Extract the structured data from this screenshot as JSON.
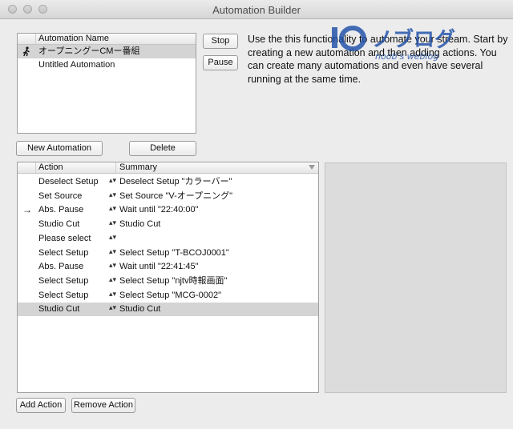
{
  "window": {
    "title": "Automation Builder"
  },
  "automations": {
    "header": "Automation Name",
    "items": [
      {
        "name": "オープニングーCMー番組",
        "running": true,
        "selected": true
      },
      {
        "name": "Untitled Automation",
        "running": false,
        "selected": false
      }
    ]
  },
  "controls": {
    "stop_label": "Stop",
    "pause_label": "Pause"
  },
  "description": "Use the this functionality to automate your stream. Start by creating a new automation and then adding actions.  You can create many automations and even have several running at the same time.",
  "watermark": {
    "text": "ノブログ",
    "subtext": "noob's weblog"
  },
  "list_buttons": {
    "new_label": "New Automation",
    "delete_label": "Delete"
  },
  "actions": {
    "header_action": "Action",
    "header_summary": "Summary",
    "rows": [
      {
        "action": "Deselect Setup",
        "summary": "Deselect Setup \"カラーバー\"",
        "current": false,
        "selected": false
      },
      {
        "action": "Set Source",
        "summary": "Set Source \"V-オープニング\"",
        "current": false,
        "selected": false
      },
      {
        "action": "Abs. Pause",
        "summary": "Wait until \"22:40:00\"",
        "current": true,
        "selected": false
      },
      {
        "action": "Studio Cut",
        "summary": "Studio Cut",
        "current": false,
        "selected": false
      },
      {
        "action": "Please select",
        "summary": "",
        "current": false,
        "selected": false
      },
      {
        "action": "Select Setup",
        "summary": "Select Setup \"T-BCOJ0001\"",
        "current": false,
        "selected": false
      },
      {
        "action": "Abs. Pause",
        "summary": "Wait until \"22:41:45\"",
        "current": false,
        "selected": false
      },
      {
        "action": "Select Setup",
        "summary": "Select Setup \"njtv時報画面\"",
        "current": false,
        "selected": false
      },
      {
        "action": "Select Setup",
        "summary": "Select Setup \"MCG-0002\"",
        "current": false,
        "selected": false
      },
      {
        "action": "Studio Cut",
        "summary": "Studio Cut",
        "current": false,
        "selected": true
      }
    ]
  },
  "bottom_buttons": {
    "add_label": "Add Action",
    "remove_label": "Remove Action"
  }
}
